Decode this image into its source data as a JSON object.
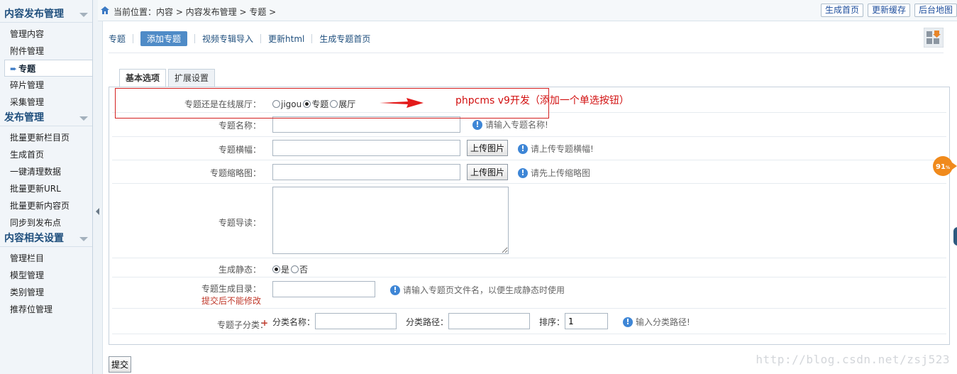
{
  "sidebar": {
    "groups": [
      {
        "title": "内容发布管理",
        "items": [
          {
            "label": "管理内容",
            "active": false
          },
          {
            "label": "附件管理",
            "active": false
          },
          {
            "label": "专题",
            "active": true
          },
          {
            "label": "碎片管理",
            "active": false
          },
          {
            "label": "采集管理",
            "active": false
          }
        ]
      },
      {
        "title": "发布管理",
        "items": [
          {
            "label": "批量更新栏目页",
            "active": false
          },
          {
            "label": "生成首页",
            "active": false
          },
          {
            "label": "一键清理数据",
            "active": false
          },
          {
            "label": "批量更新URL",
            "active": false
          },
          {
            "label": "批量更新内容页",
            "active": false
          },
          {
            "label": "同步到发布点",
            "active": false
          }
        ]
      },
      {
        "title": "内容相关设置",
        "items": [
          {
            "label": "管理栏目",
            "active": false
          },
          {
            "label": "模型管理",
            "active": false
          },
          {
            "label": "类别管理",
            "active": false
          },
          {
            "label": "推荐位管理",
            "active": false
          }
        ]
      }
    ]
  },
  "topbar": {
    "breadcrumb": "当前位置：内容 > 内容发布管理 > 专题 >",
    "actions": [
      "生成首页",
      "更新缓存",
      "后台地图"
    ]
  },
  "subnav": [
    {
      "label": "专题",
      "active": false
    },
    {
      "label": "添加专题",
      "active": true
    },
    {
      "label": "视频专辑导入",
      "active": false
    },
    {
      "label": "更新html",
      "active": false
    },
    {
      "label": "生成专题首页",
      "active": false
    }
  ],
  "tabs": [
    {
      "label": "基本选项",
      "active": true
    },
    {
      "label": "扩展设置",
      "active": false
    }
  ],
  "form": {
    "type_label": "专题还是在线展厅：",
    "type_options": [
      {
        "label": "jigou",
        "checked": false
      },
      {
        "label": "专题",
        "checked": true
      },
      {
        "label": "展厅",
        "checked": false
      }
    ],
    "name_label": "专题名称：",
    "name_value": "",
    "name_hint": "请输入专题名称!",
    "banner_label": "专题横幅：",
    "banner_value": "",
    "banner_button": "上传图片",
    "banner_hint": "请上传专题横幅!",
    "thumb_label": "专题缩略图：",
    "thumb_value": "",
    "thumb_button": "上传图片",
    "thumb_hint": "请先上传缩略图",
    "intro_label": "专题导读：",
    "intro_value": "",
    "static_label": "生成静态：",
    "static_options": [
      {
        "label": "是",
        "checked": true
      },
      {
        "label": "否",
        "checked": false
      }
    ],
    "dir_label": "专题生成目录：",
    "dir_note": "提交后不能修改",
    "dir_value": "",
    "dir_hint": "请输入专题页文件名，以便生成静态时使用",
    "sub_label": "专题子分类：",
    "sub_plus": "+",
    "sub_name_label": "分类名称：",
    "sub_name_value": "",
    "sub_path_label": "分类路径：",
    "sub_path_value": "",
    "sub_order_label": "排序：",
    "sub_order_value": "1",
    "sub_hint": "输入分类路径!"
  },
  "annotation": {
    "text": "phpcms v9开发（添加一个单选按钮）",
    "color": "#d42020"
  },
  "submit_label": "提交",
  "badge": {
    "value": "91",
    "unit": "%"
  },
  "watermark": "http://blog.csdn.net/zsj523",
  "colors": {
    "accent": "#4f8bc7",
    "link": "#1f4f7d",
    "info": "#3e86d6",
    "warning": "#c0392b"
  }
}
